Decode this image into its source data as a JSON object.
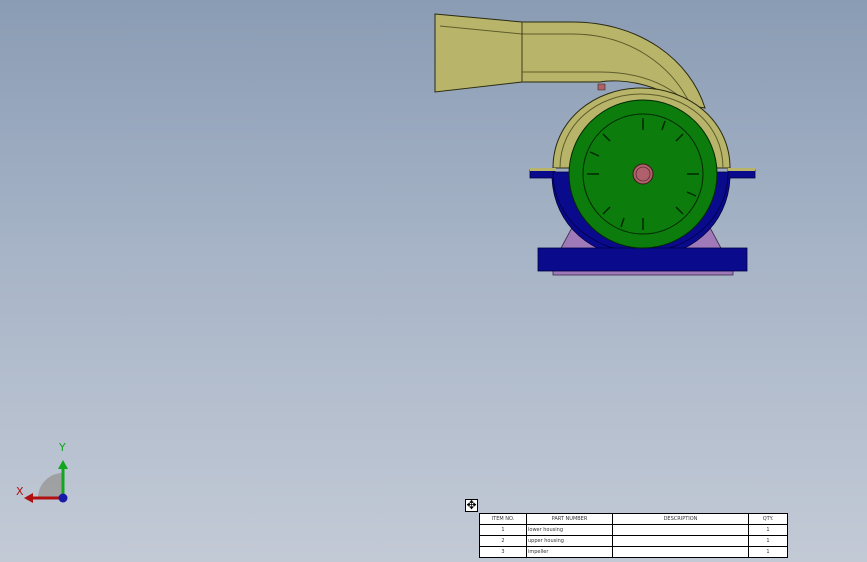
{
  "triad": {
    "y_label": "Y",
    "x_label": "X",
    "colors": {
      "x_axis": "#b01010",
      "y_axis": "#12a51e",
      "z_axis": "#1a1aa8"
    }
  },
  "model": {
    "colors": {
      "blower_housing": "#b8b56a",
      "impeller": "#0c7c0c",
      "hub": "#b0606a",
      "base_frame": "#0a0a8c",
      "support": "#a07ab8"
    }
  },
  "bom": {
    "move_icon": "move-handle-icon",
    "headers": {
      "item_no": "ITEM NO.",
      "part_number": "PART NUMBER",
      "description": "DESCRIPTION",
      "qty": "QTY."
    },
    "rows": [
      {
        "item_no": "1",
        "part_number": "lower housing",
        "description": "",
        "qty": "1"
      },
      {
        "item_no": "2",
        "part_number": "upper housing",
        "description": "",
        "qty": "1"
      },
      {
        "item_no": "3",
        "part_number": "impeller",
        "description": "",
        "qty": "1"
      }
    ]
  }
}
